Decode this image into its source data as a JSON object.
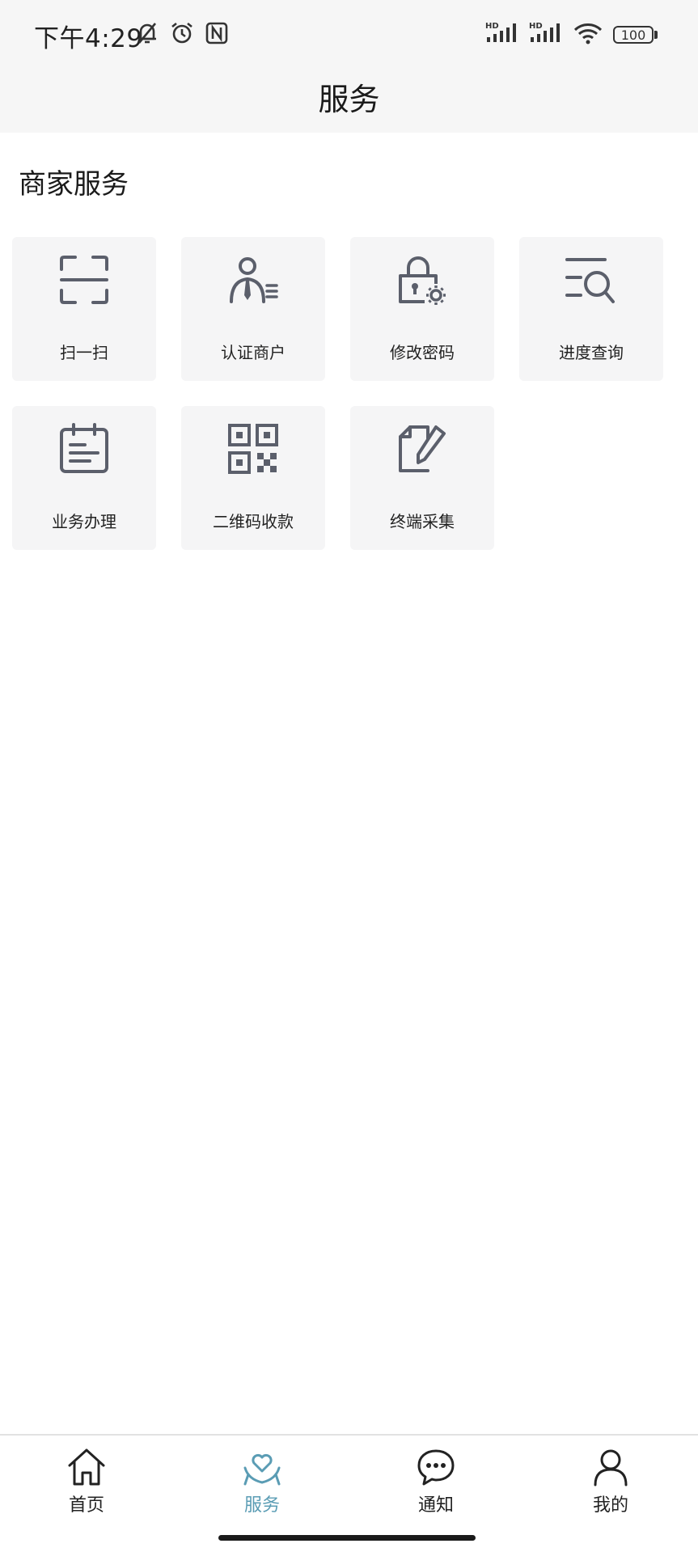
{
  "status_bar": {
    "time": "下午4:29",
    "left_icons": [
      "bell-off-icon",
      "alarm-icon",
      "nfc-icon"
    ],
    "signal_labels": [
      "HD",
      "HD"
    ],
    "battery": "100"
  },
  "header": {
    "title": "服务"
  },
  "section": {
    "title": "商家服务"
  },
  "services": [
    {
      "label": "扫一扫",
      "icon": "scan-icon"
    },
    {
      "label": "认证商户",
      "icon": "merchant-certify-icon"
    },
    {
      "label": "修改密码",
      "icon": "lock-settings-icon"
    },
    {
      "label": "进度查询",
      "icon": "progress-search-icon"
    },
    {
      "label": "业务办理",
      "icon": "business-calendar-icon"
    },
    {
      "label": "二维码收款",
      "icon": "qr-code-icon"
    },
    {
      "label": "终端采集",
      "icon": "edit-document-icon"
    }
  ],
  "bottom_nav": {
    "items": [
      {
        "label": "首页",
        "icon": "home-icon"
      },
      {
        "label": "服务",
        "icon": "service-heart-icon",
        "active": true
      },
      {
        "label": "通知",
        "icon": "chat-bubble-icon"
      },
      {
        "label": "我的",
        "icon": "user-icon"
      }
    ]
  },
  "colors": {
    "accent": "#5a9cb4",
    "icon": "#5b5f6b",
    "tile_bg": "#f5f5f6",
    "header_bg": "#f6f6f6"
  }
}
